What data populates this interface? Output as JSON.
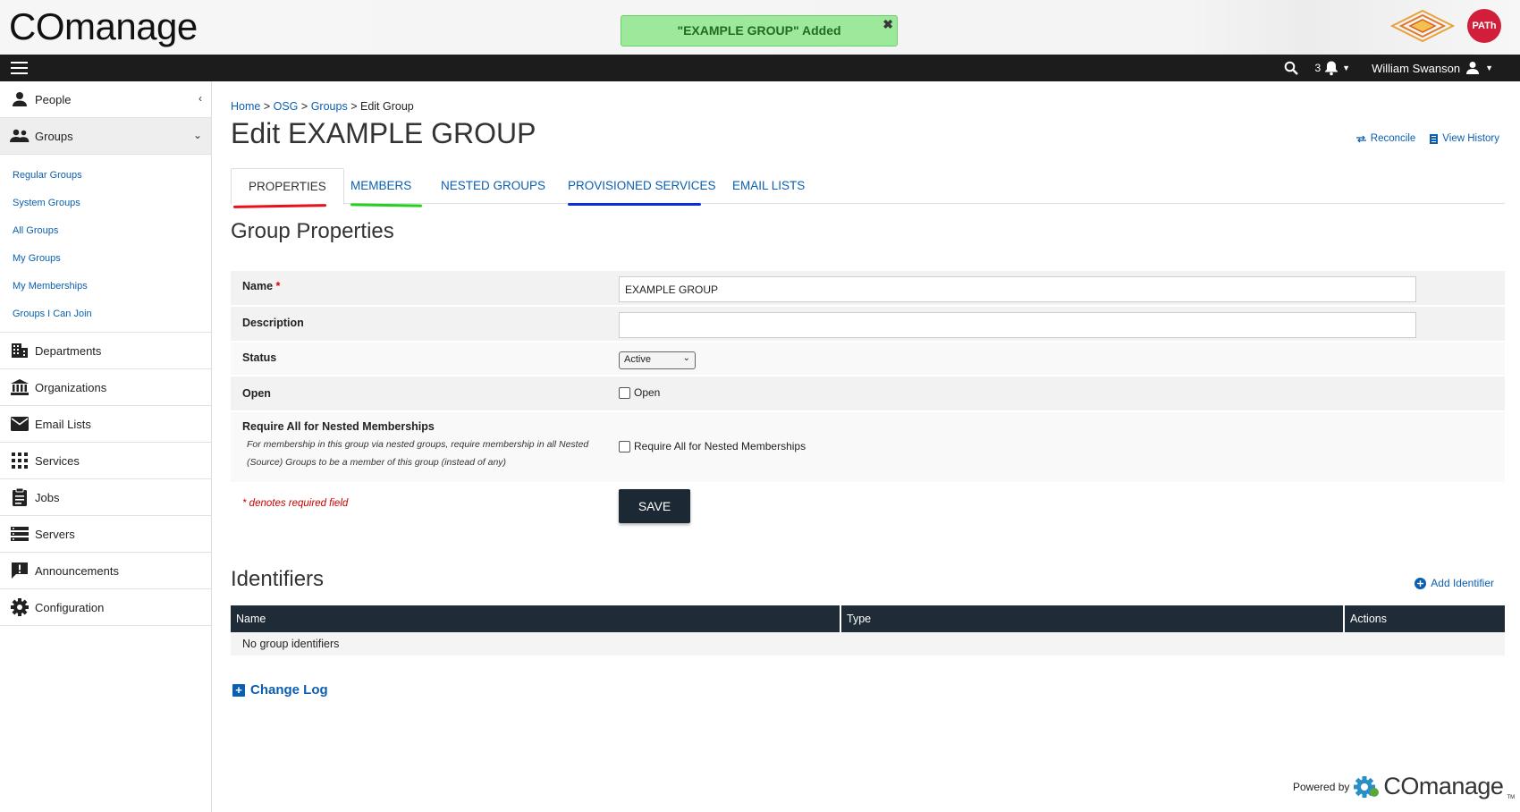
{
  "header": {
    "brand": "COmanage",
    "flash_message": "\"EXAMPLE GROUP\" Added",
    "flash_close": "✖",
    "path_logo": "PATh"
  },
  "navbar": {
    "notifications_count": "3",
    "user_name": "William Swanson"
  },
  "sidebar": {
    "items": [
      {
        "label": "People",
        "icon": "person-icon"
      },
      {
        "label": "Groups",
        "icon": "groups-icon"
      }
    ],
    "group_links": [
      "Regular Groups",
      "System Groups",
      "All Groups",
      "My Groups",
      "My Memberships",
      "Groups I Can Join"
    ],
    "more_items": [
      {
        "label": "Departments",
        "icon": "building-icon"
      },
      {
        "label": "Organizations",
        "icon": "bank-icon"
      },
      {
        "label": "Email Lists",
        "icon": "mail-icon"
      },
      {
        "label": "Services",
        "icon": "grid-icon"
      },
      {
        "label": "Jobs",
        "icon": "clipboard-icon"
      },
      {
        "label": "Servers",
        "icon": "servers-icon"
      },
      {
        "label": "Announcements",
        "icon": "announcement-icon"
      },
      {
        "label": "Configuration",
        "icon": "gear-icon"
      }
    ]
  },
  "breadcrumb": {
    "home": "Home",
    "osg": "OSG",
    "groups": "Groups",
    "current": "Edit Group",
    "sep": ">"
  },
  "page": {
    "title": "Edit EXAMPLE GROUP",
    "reconcile": "Reconcile",
    "view_history": "View History"
  },
  "tabs": [
    "PROPERTIES",
    "MEMBERS",
    "NESTED GROUPS",
    "PROVISIONED SERVICES",
    "EMAIL LISTS"
  ],
  "tab_underline_colors": {
    "properties": "#e8101a",
    "members": "#25d11c",
    "provisioned": "#0a2ed8"
  },
  "form": {
    "section_title": "Group Properties",
    "name_label": "Name",
    "name_required": "*",
    "name_value": "EXAMPLE GROUP",
    "description_label": "Description",
    "description_value": "",
    "status_label": "Status",
    "status_value": "Active",
    "open_label": "Open",
    "open_checkbox_label": "Open",
    "nested_label": "Require All for Nested Memberships",
    "nested_help": "For membership in this group via nested groups, require membership in all Nested (Source) Groups to be a member of this group (instead of any)",
    "nested_checkbox_label": "Require All for Nested Memberships",
    "required_note": "* denotes required field",
    "save_label": "SAVE"
  },
  "identifiers": {
    "section_title": "Identifiers",
    "add_label": "Add Identifier",
    "columns": [
      "Name",
      "Type",
      "Actions"
    ],
    "empty_text": "No group identifiers"
  },
  "change_log": "Change Log",
  "footer": {
    "powered_by": "Powered by",
    "logo_text": "COmanage",
    "tm": "TM"
  }
}
